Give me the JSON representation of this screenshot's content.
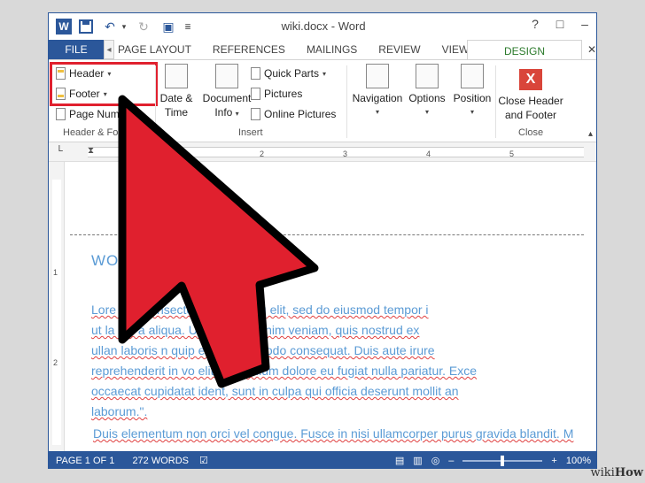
{
  "window": {
    "title": "wiki.docx - Word"
  },
  "titlebar": {
    "help": "?",
    "restore": "□",
    "minimize": "–",
    "close": "✕",
    "word_letter": "W"
  },
  "tabs": {
    "file": "FILE",
    "items": [
      "PAGE LAYOUT",
      "REFERENCES",
      "MAILINGS",
      "REVIEW",
      "VIEW"
    ],
    "design": "DESIGN",
    "scroll_left": "◂"
  },
  "ribbon": {
    "header_label": "Header",
    "footer_label": "Footer",
    "page_number_label": "Page Num",
    "group_header_footer": "Header & Fo",
    "date_time": [
      "Date &",
      "Time"
    ],
    "document_info": [
      "Document",
      "Info"
    ],
    "quick_parts": "Quick Parts",
    "pictures": "Pictures",
    "online_pictures": "Online Pictures",
    "group_insert": "Insert",
    "navigation": "Navigation",
    "options": "Options",
    "position": "Position",
    "close_header_footer": [
      "Close Header",
      "and Footer"
    ],
    "group_close": "Close",
    "close_x": "X"
  },
  "ruler": {
    "numbers": [
      "1",
      "2",
      "3",
      "4",
      "5"
    ],
    "vertical_numbers": [
      "1",
      "2"
    ]
  },
  "document": {
    "heading": "WO",
    "lines": [
      "Lore        net, consectetur adipiscing elit, sed do eiusmod tempor i",
      "ut la        dol        a aliqua. Ut enim ad minim veniam, quis nostrud ex",
      "ullan     laboris    n      quip ex ea commodo consequat. Duis aute irure",
      "reprehenderit in vo          elit esse cillum dolore eu fugiat nulla pariatur. Exce",
      "occaecat cupidatat           ident, sunt in culpa qui officia deserunt mollit an",
      "laborum.\"."
    ],
    "line2": "Duis elementum non orci vel congue. Fusce in nisi ullamcorper purus gravida blandit. M"
  },
  "status": {
    "page": "PAGE 1 OF 1",
    "words": "272 WORDS",
    "zoom": "100%",
    "zoom_level": 0.5
  },
  "watermark": {
    "wiki": "wiki",
    "how": "How"
  },
  "colors": {
    "accent": "#2b579a",
    "arrow": "#e0202e",
    "doc_text": "#5b9bd5",
    "design_tab": "#2b7a2b"
  }
}
